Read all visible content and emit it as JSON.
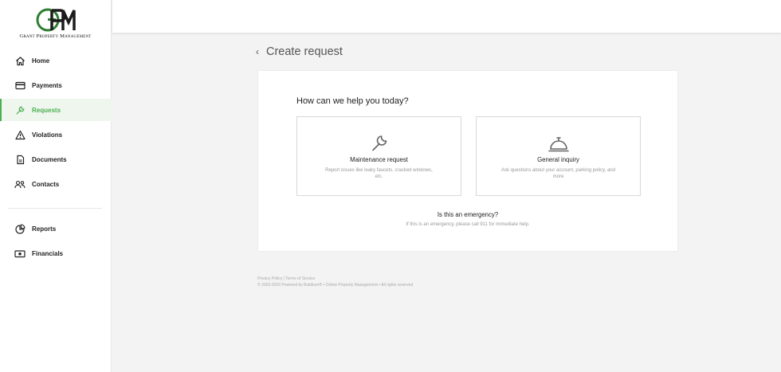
{
  "brand": {
    "logo_letters": "GPM",
    "name": "Grant Property Management",
    "colors": {
      "green": "#2e7d32",
      "dark": "#1b1b1b"
    }
  },
  "sidebar": {
    "items": [
      {
        "label": "Home",
        "icon": "home-icon"
      },
      {
        "label": "Payments",
        "icon": "credit-card-icon"
      },
      {
        "label": "Requests",
        "icon": "wrench-icon",
        "active": true
      },
      {
        "label": "Violations",
        "icon": "warning-icon"
      },
      {
        "label": "Documents",
        "icon": "document-icon"
      },
      {
        "label": "Contacts",
        "icon": "contacts-icon"
      }
    ],
    "secondary_items": [
      {
        "label": "Reports",
        "icon": "pie-chart-icon"
      },
      {
        "label": "Financials",
        "icon": "cash-icon"
      }
    ],
    "active_color": "#4caf50"
  },
  "header": {
    "back_glyph": "‹",
    "title": "Create request"
  },
  "card": {
    "question": "How can we help you today?",
    "options": [
      {
        "title": "Maintenance request",
        "description": "Report issues like leaky faucets, cracked windows, etc.",
        "icon": "wrench-icon"
      },
      {
        "title": "General inquiry",
        "description": "Ask questions about your account, parking policy, and more",
        "icon": "service-bell-icon"
      }
    ],
    "emergency": {
      "title": "Is this an emergency?",
      "description": "If this is an emergency, please call 911 for immediate help."
    }
  },
  "footer": {
    "privacy": "Privacy Policy",
    "separator": "|",
    "terms": "Terms of Service",
    "copyright": "© 2003-2020 Powered by Buildium® • Online Property Management • All rights reserved"
  }
}
